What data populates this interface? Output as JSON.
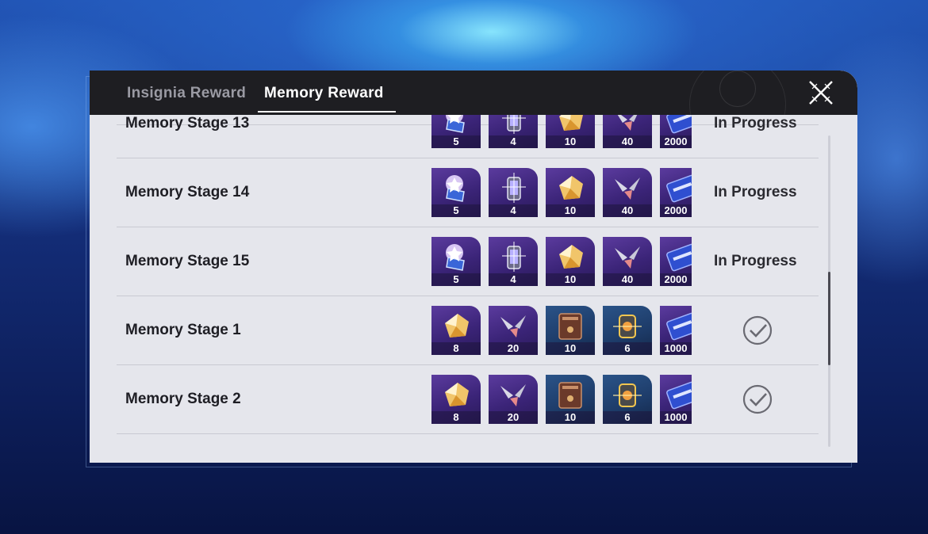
{
  "tabs": [
    {
      "label": "Insignia Reward",
      "active": false
    },
    {
      "label": "Memory Reward",
      "active": true
    }
  ],
  "close_icon": "close-x-icon",
  "colors": {
    "accent": "#ffffff",
    "item_purple": "#4a2f8a",
    "item_blue": "#1f4272",
    "panel": "#e5e6ec",
    "header": "#1e1e22"
  },
  "rows": [
    {
      "name": "Memory Stage 13",
      "status": "In Progress",
      "completed": false,
      "rewards": [
        {
          "icon": "ticket-badge-icon",
          "qty": "5"
        },
        {
          "icon": "lantern-icon",
          "qty": "4"
        },
        {
          "icon": "gold-crystal-icon",
          "qty": "10"
        },
        {
          "icon": "shard-icon",
          "qty": "40"
        },
        {
          "icon": "credit-card-icon",
          "qty": "2000"
        }
      ]
    },
    {
      "name": "Memory Stage 14",
      "status": "In Progress",
      "completed": false,
      "rewards": [
        {
          "icon": "ticket-badge-icon",
          "qty": "5"
        },
        {
          "icon": "lantern-icon",
          "qty": "4"
        },
        {
          "icon": "gold-crystal-icon",
          "qty": "10"
        },
        {
          "icon": "shard-icon",
          "qty": "40"
        },
        {
          "icon": "credit-card-icon",
          "qty": "2000"
        }
      ]
    },
    {
      "name": "Memory Stage 15",
      "status": "In Progress",
      "completed": false,
      "rewards": [
        {
          "icon": "ticket-badge-icon",
          "qty": "5"
        },
        {
          "icon": "lantern-icon",
          "qty": "4"
        },
        {
          "icon": "gold-crystal-icon",
          "qty": "10"
        },
        {
          "icon": "shard-icon",
          "qty": "40"
        },
        {
          "icon": "credit-card-icon",
          "qty": "2000"
        }
      ]
    },
    {
      "name": "Memory Stage 1",
      "status": "",
      "completed": true,
      "rewards": [
        {
          "icon": "gold-crystal-icon",
          "qty": "8"
        },
        {
          "icon": "shard-icon",
          "qty": "20"
        },
        {
          "icon": "book-icon",
          "qty": "10"
        },
        {
          "icon": "canister-icon",
          "qty": "6"
        },
        {
          "icon": "credit-card-icon",
          "qty": "1000"
        }
      ]
    },
    {
      "name": "Memory Stage 2",
      "status": "",
      "completed": true,
      "rewards": [
        {
          "icon": "gold-crystal-icon",
          "qty": "8"
        },
        {
          "icon": "shard-icon",
          "qty": "20"
        },
        {
          "icon": "book-icon",
          "qty": "10"
        },
        {
          "icon": "canister-icon",
          "qty": "6"
        },
        {
          "icon": "credit-card-icon",
          "qty": "1000"
        }
      ]
    }
  ],
  "scroll": {
    "position": 0.44
  }
}
